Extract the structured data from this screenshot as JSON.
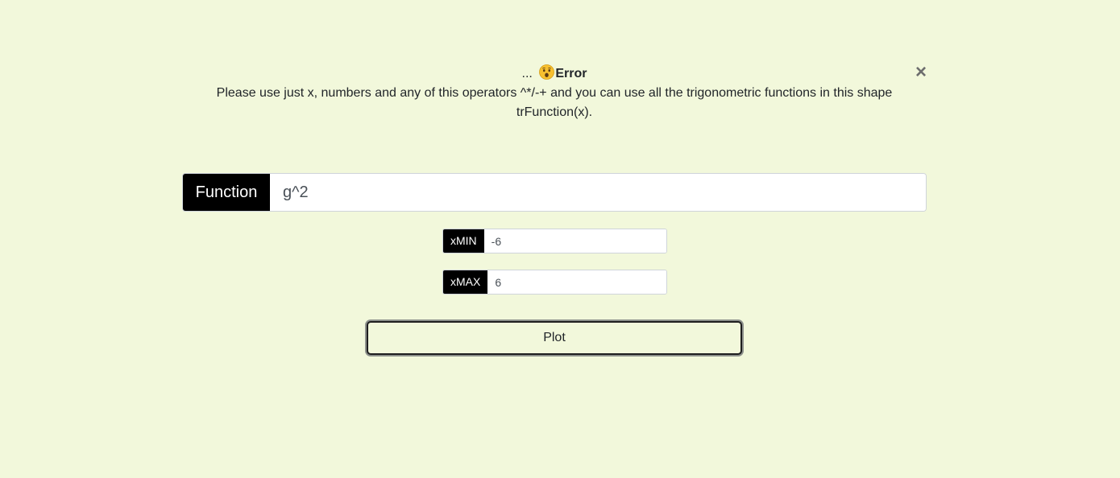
{
  "alert": {
    "prefix": "...",
    "title": "Error",
    "emoji_icon": "astonished-face-icon",
    "message": "Please use just x, numbers and any of this operators ^*/-+ and you can use all the trigonometric functions in this shape trFunction(x).",
    "close_label": "×"
  },
  "function_field": {
    "label": "Function",
    "value": "g^2"
  },
  "xmin_field": {
    "label": "xMIN",
    "value": "-6"
  },
  "xmax_field": {
    "label": "xMAX",
    "value": "6"
  },
  "plot_button": {
    "label": "Plot"
  },
  "colors": {
    "background": "#f2f8db",
    "label_background": "#000000",
    "label_text": "#ffffff",
    "close_icon": "#6d6d6d"
  }
}
